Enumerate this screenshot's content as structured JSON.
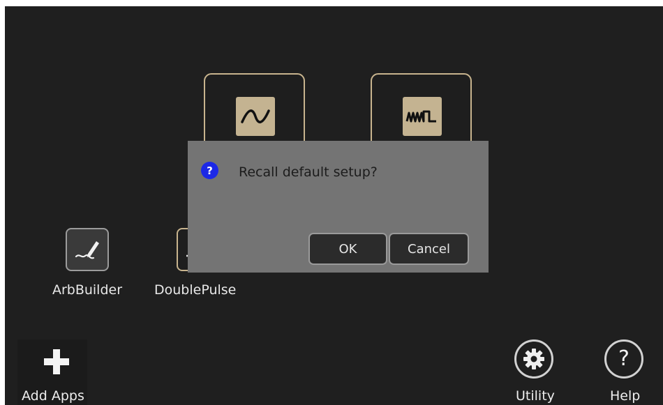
{
  "modes": [
    {
      "icon": "sine-wave-icon"
    },
    {
      "icon": "pulse-wave-icon"
    }
  ],
  "apps": [
    {
      "label": "ArbBuilder",
      "icon": "pen-signature-icon"
    },
    {
      "label": "DoublePulse",
      "icon": "double-pulse-icon"
    }
  ],
  "bottom_bar": {
    "add_apps": "Add Apps",
    "utility": "Utility",
    "help": "Help"
  },
  "dialog": {
    "message": "Recall default setup?",
    "icon_glyph": "?",
    "ok": "OK",
    "cancel": "Cancel"
  },
  "colors": {
    "background": "#1f1f1f",
    "tile_border": "#c8b48e",
    "dialog": "#747474",
    "question_icon": "#1c28e6"
  }
}
